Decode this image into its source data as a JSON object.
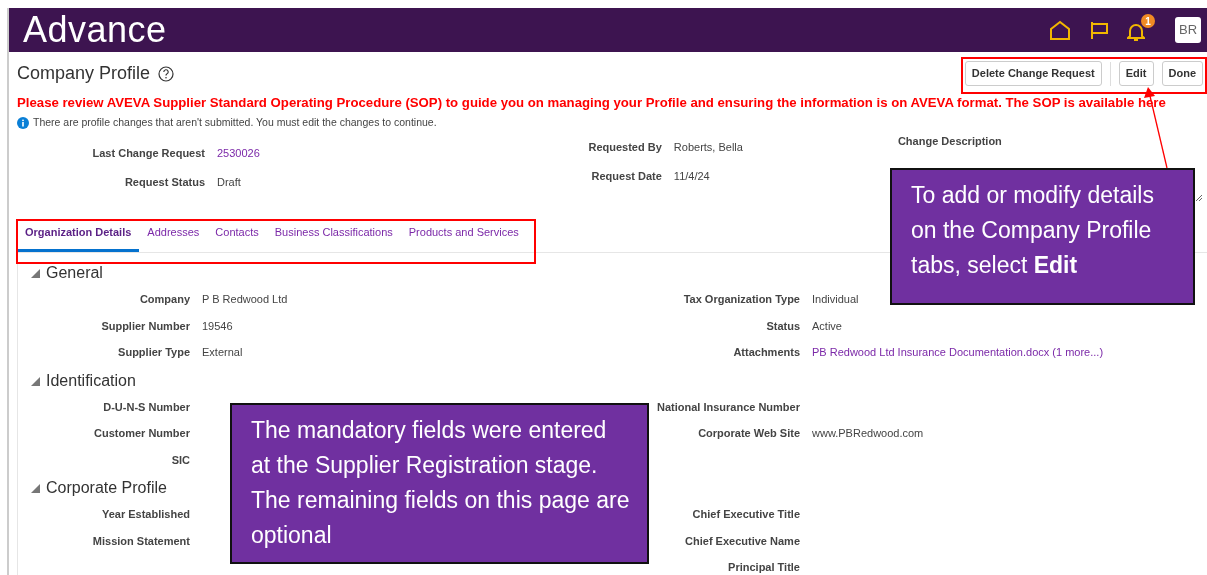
{
  "header": {
    "brand": "Advance",
    "notification_count": "1",
    "avatar_initials": "BR"
  },
  "page": {
    "title": "Company Profile",
    "buttons": [
      "Delete Change Request",
      "Edit",
      "Done"
    ]
  },
  "notice": "Please review AVEVA Supplier Standard Operating Procedure (SOP) to guide you on managing your Profile and ensuring the information is on AVEVA format. The SOP is available here",
  "info_message": "There are profile changes that aren't submitted. You must edit the changes to continue.",
  "request": {
    "left": [
      {
        "label": "Last Change Request",
        "value": "2530026",
        "kind": "link"
      },
      {
        "label": "Request Status",
        "value": "Draft",
        "kind": "text"
      }
    ],
    "middle": [
      {
        "label": "Requested By",
        "value": "Roberts, Bella",
        "kind": "text"
      },
      {
        "label": "Request Date",
        "value": "11/4/24",
        "kind": "text"
      }
    ],
    "change_description_label": "Change Description"
  },
  "tabs": [
    {
      "label": "Organization Details",
      "selected": true
    },
    {
      "label": "Addresses",
      "selected": false
    },
    {
      "label": "Contacts",
      "selected": false
    },
    {
      "label": "Business Classifications",
      "selected": false
    },
    {
      "label": "Products and Services",
      "selected": false
    }
  ],
  "sections": [
    {
      "title": "General",
      "expanded": true,
      "left": [
        {
          "label": "Company",
          "value": "P B Redwood Ltd",
          "kind": "text"
        },
        {
          "label": "Supplier Number",
          "value": "19546",
          "kind": "text"
        },
        {
          "label": "Supplier Type",
          "value": "External",
          "kind": "text"
        }
      ],
      "right": [
        {
          "label": "Tax Organization Type",
          "value": "Individual",
          "kind": "text"
        },
        {
          "label": "Status",
          "value": "Active",
          "kind": "text"
        },
        {
          "label": "Attachments",
          "value": "PB Redwood Ltd Insurance Documentation.docx (1 more...)",
          "kind": "link"
        }
      ]
    },
    {
      "title": "Identification",
      "expanded": true,
      "left": [
        {
          "label": "D-U-N-S Number"
        },
        {
          "label": "Customer Number"
        },
        {
          "label": "SIC"
        }
      ],
      "right": [
        {
          "label": "National Insurance Number"
        },
        {
          "label": "Corporate Web Site",
          "value": "www.PBRedwood.com",
          "kind": "text"
        }
      ]
    },
    {
      "title": "Corporate Profile",
      "expanded": true,
      "left": [
        {
          "label": "Year Established"
        },
        {
          "label": "Mission Statement"
        }
      ],
      "right": [
        {
          "label": "Chief Executive Title"
        },
        {
          "label": "Chief Executive Name"
        },
        {
          "label": "Principal Title"
        }
      ]
    }
  ],
  "callouts": [
    {
      "text": "To add or modify details on the Company Profile tabs, select **Edit**"
    },
    {
      "text": "The mandatory fields were entered at the Supplier Registration stage.  The remaining fields on this page are optional"
    }
  ]
}
